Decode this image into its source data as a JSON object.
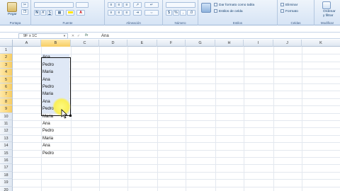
{
  "ribbon": {
    "paste_label": "Pegar",
    "groups": [
      {
        "label": "Portapa"
      },
      {
        "label": "Fuente"
      },
      {
        "label": "Alineación"
      },
      {
        "label": "Número"
      },
      {
        "label": "Estilos"
      },
      {
        "label": "Celdas"
      },
      {
        "label": "Modificar"
      }
    ],
    "font_buttons": [
      "N",
      "K",
      "S"
    ],
    "styles_items": [
      "Dar formato como tabla",
      "Estilos de celda"
    ],
    "cells_items": [
      "Eliminar",
      "Formato"
    ],
    "modify_items": [
      "Ordenar",
      "y filtrar"
    ]
  },
  "formula_bar": {
    "name_box": "9F x 1C",
    "fx_label": "fx",
    "value": "Ana"
  },
  "columns": [
    "A",
    "B",
    "C",
    "D",
    "E",
    "F",
    "G",
    "H",
    "I",
    "J",
    "K"
  ],
  "active_column": "B",
  "rows": [
    "1",
    "2",
    "3",
    "4",
    "5",
    "6",
    "7",
    "8",
    "9",
    "10",
    "11",
    "12",
    "13",
    "14",
    "15",
    "16",
    "17",
    "18",
    "19",
    "20"
  ],
  "selected_rows": [
    "2",
    "3",
    "4",
    "5",
    "6",
    "7",
    "8",
    "9"
  ],
  "column_b": [
    {
      "row": "2",
      "value": "Ana"
    },
    {
      "row": "3",
      "value": "Pedro"
    },
    {
      "row": "4",
      "value": "Maria"
    },
    {
      "row": "5",
      "value": "Ana"
    },
    {
      "row": "6",
      "value": "Pedro"
    },
    {
      "row": "7",
      "value": "Maria"
    },
    {
      "row": "8",
      "value": "Ana"
    },
    {
      "row": "9",
      "value": "Pedro"
    },
    {
      "row": "10",
      "value": "Maria"
    },
    {
      "row": "11",
      "value": "Ana"
    },
    {
      "row": "12",
      "value": "Pedro"
    },
    {
      "row": "13",
      "value": "Maria"
    },
    {
      "row": "14",
      "value": "Ana"
    },
    {
      "row": "15",
      "value": "Pedro"
    }
  ],
  "colors": {
    "selection_fill": "#dfe8f6",
    "header_active": "#f7cd63",
    "cursor_highlight": "#fff23c"
  }
}
